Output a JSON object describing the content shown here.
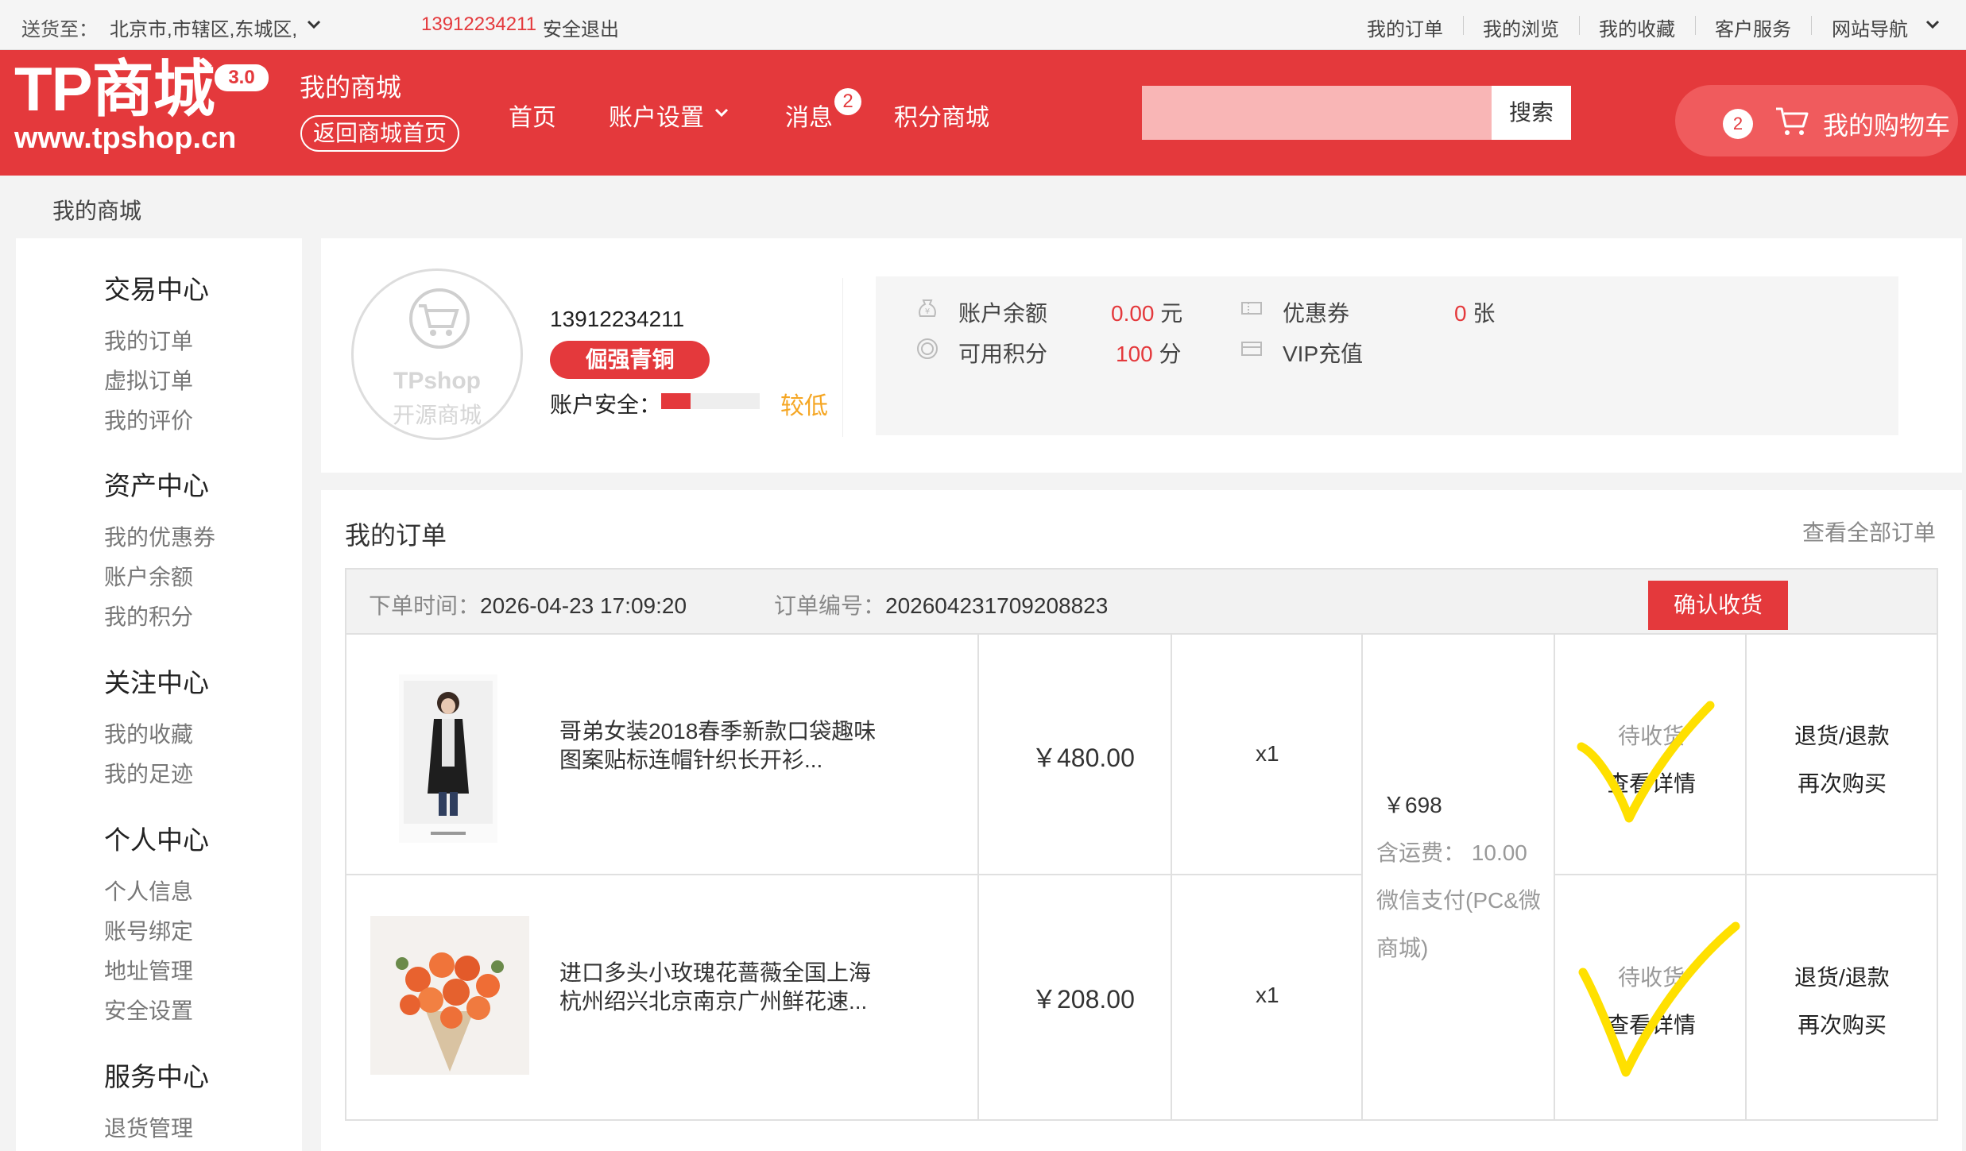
{
  "topbar": {
    "ship_label": "送货至：",
    "address": "北京市,市辖区,东城区,",
    "user_phone": "13912234211",
    "logout": "安全退出",
    "links": [
      "我的订单",
      "我的浏览",
      "我的收藏",
      "客户服务",
      "网站导航"
    ]
  },
  "header": {
    "logo_text": "TP商城",
    "logo_version": "3.0",
    "logo_url": "www.tpshop.cn",
    "mall_title": "我的商城",
    "back_home": "返回商城首页",
    "nav": {
      "home": "首页",
      "account": "账户设置",
      "messages": "消息",
      "messages_count": "2",
      "points_mall": "积分商城"
    },
    "search": {
      "placeholder": "",
      "button": "搜索"
    },
    "cart": {
      "count": "2",
      "label": "我的购物车"
    }
  },
  "breadcrumb": "我的商城",
  "sidebar": {
    "sections": [
      {
        "title": "交易中心",
        "items": [
          "我的订单",
          "虚拟订单",
          "我的评价"
        ]
      },
      {
        "title": "资产中心",
        "items": [
          "我的优惠券",
          "账户余额",
          "我的积分"
        ]
      },
      {
        "title": "关注中心",
        "items": [
          "我的收藏",
          "我的足迹"
        ]
      },
      {
        "title": "个人中心",
        "items": [
          "个人信息",
          "账号绑定",
          "地址管理",
          "安全设置"
        ]
      },
      {
        "title": "服务中心",
        "items": [
          "退货管理"
        ]
      }
    ]
  },
  "user": {
    "avatar_brand": "TPshop",
    "avatar_caption": "开源商城",
    "phone": "13912234211",
    "level": "倔强青铜",
    "security_label": "账户安全：",
    "security_level": "较低",
    "security_fraction": 0.3
  },
  "assets": {
    "balance": {
      "label": "账户余额",
      "value": "0.00",
      "unit": "元"
    },
    "points": {
      "label": "可用积分",
      "value": "100",
      "unit": "分"
    },
    "coupons": {
      "label": "优惠券",
      "value": "0",
      "unit": "张"
    },
    "vip": {
      "label": "VIP充值"
    }
  },
  "orders": {
    "title": "我的订单",
    "view_all": "查看全部订单",
    "order": {
      "time_label": "下单时间：",
      "time": "2026-04-23 17:09:20",
      "number_label": "订单编号：",
      "number": "202604231709208823",
      "confirm_button": "确认收货",
      "total": "￥698",
      "shipping_label": "含运费：",
      "shipping": "10.00",
      "payment_line1": "微信支付(PC&微",
      "payment_line2": "商城)",
      "items": [
        {
          "name_line1": "哥弟女装2018春季新款口袋趣味",
          "name_line2": "图案贴标连帽针织长开衫...",
          "price": "￥480.00",
          "qty": "x1",
          "status": "待收货",
          "detail": "查看详情",
          "return": "退货/退款",
          "rebuy": "再次购买"
        },
        {
          "name_line1": "进口多头小玫瑰花蔷薇全国上海",
          "name_line2": "杭州绍兴北京南京广州鲜花速...",
          "price": "￥208.00",
          "qty": "x1",
          "status": "待收货",
          "detail": "查看详情",
          "return": "退货/退款",
          "rebuy": "再次购买"
        }
      ]
    }
  },
  "colors": {
    "brand_red": "#e4393c",
    "highlight_yellow": "#ffe000",
    "warning_orange": "#f5a623"
  }
}
